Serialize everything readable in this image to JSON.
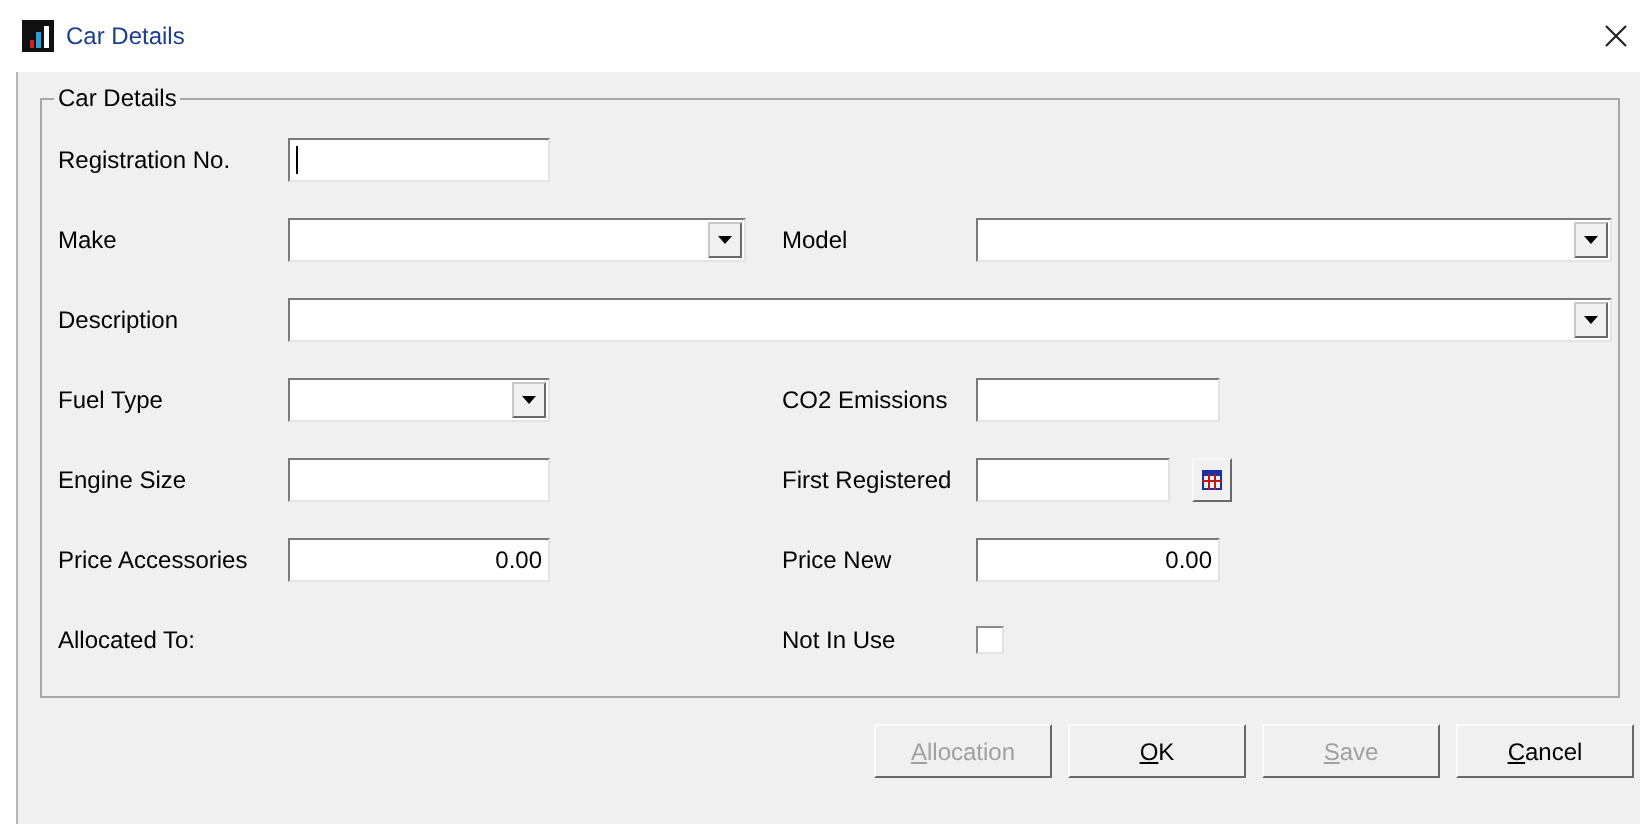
{
  "window": {
    "title": "Car Details"
  },
  "group": {
    "title": "Car Details"
  },
  "rows": [
    {
      "left": {
        "label": "Registration No.",
        "kind": "text",
        "focused": true
      }
    },
    {
      "left": {
        "label": "Make",
        "kind": "combo"
      },
      "right": {
        "label": "Model",
        "kind": "combo"
      }
    },
    {
      "left": {
        "label": "Description",
        "kind": "wide_combo"
      }
    },
    {
      "left": {
        "label": "Fuel Type",
        "kind": "combo"
      },
      "right": {
        "label": "CO2 Emissions",
        "kind": "text"
      }
    },
    {
      "left": {
        "label": "Engine Size",
        "kind": "text"
      },
      "right": {
        "label": "First Registered",
        "kind": "date"
      }
    },
    {
      "left": {
        "label": "Price Accessories",
        "kind": "text",
        "value": "0.00"
      },
      "right": {
        "label": "Price New",
        "kind": "text",
        "value": "0.00"
      }
    },
    {
      "left": {
        "label": "Allocated To:",
        "kind": "label"
      },
      "right": {
        "label": "Not In Use",
        "kind": "checkbox",
        "checked": false
      }
    }
  ],
  "buttons": [
    {
      "access": "A",
      "rest": "llocation",
      "disabled": true
    },
    {
      "access": "O",
      "rest": "K",
      "disabled": false
    },
    {
      "access": "S",
      "rest": "ave",
      "disabled": true
    },
    {
      "access": "C",
      "rest": "ancel",
      "disabled": false
    }
  ]
}
